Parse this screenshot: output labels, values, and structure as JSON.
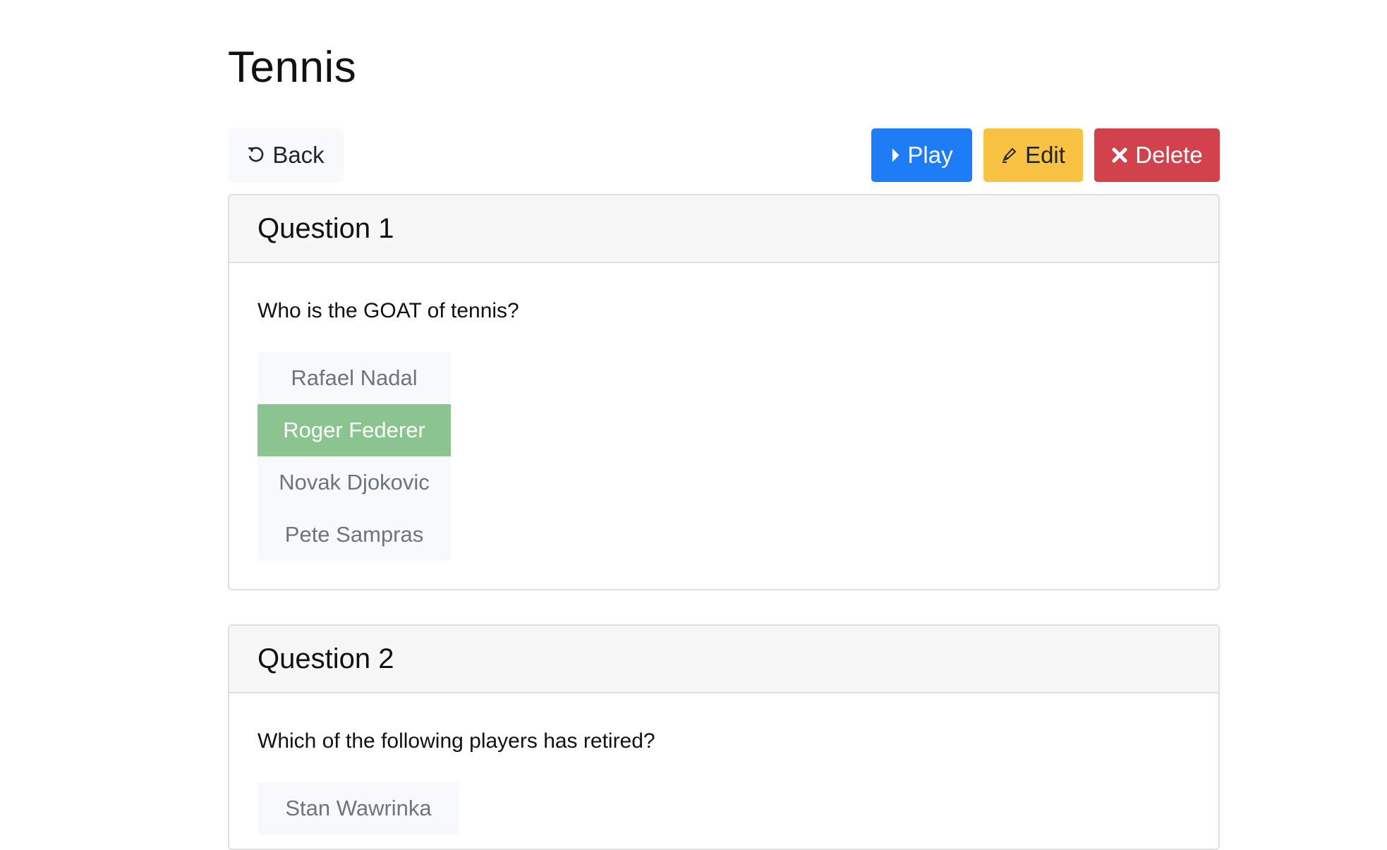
{
  "page": {
    "title": "Tennis"
  },
  "toolbar": {
    "back_label": "Back",
    "back_icon": "undo-icon",
    "play_label": "Play",
    "play_icon": "caret-right-icon",
    "edit_label": "Edit",
    "edit_icon": "pencil-icon",
    "delete_label": "Delete",
    "delete_icon": "x-icon"
  },
  "colors": {
    "play": "#1f7cf7",
    "edit": "#f8c342",
    "delete": "#d2424b",
    "correct_answer": "#8bc48f"
  },
  "questions": [
    {
      "header": "Question 1",
      "text": "Who is the GOAT of tennis?",
      "options": [
        {
          "label": "Rafael Nadal",
          "correct": false
        },
        {
          "label": "Roger Federer",
          "correct": true
        },
        {
          "label": "Novak Djokovic",
          "correct": false
        },
        {
          "label": "Pete Sampras",
          "correct": false
        }
      ]
    },
    {
      "header": "Question 2",
      "text": "Which of the following players has retired?",
      "options": [
        {
          "label": "Stan Wawrinka",
          "correct": false
        }
      ]
    }
  ]
}
